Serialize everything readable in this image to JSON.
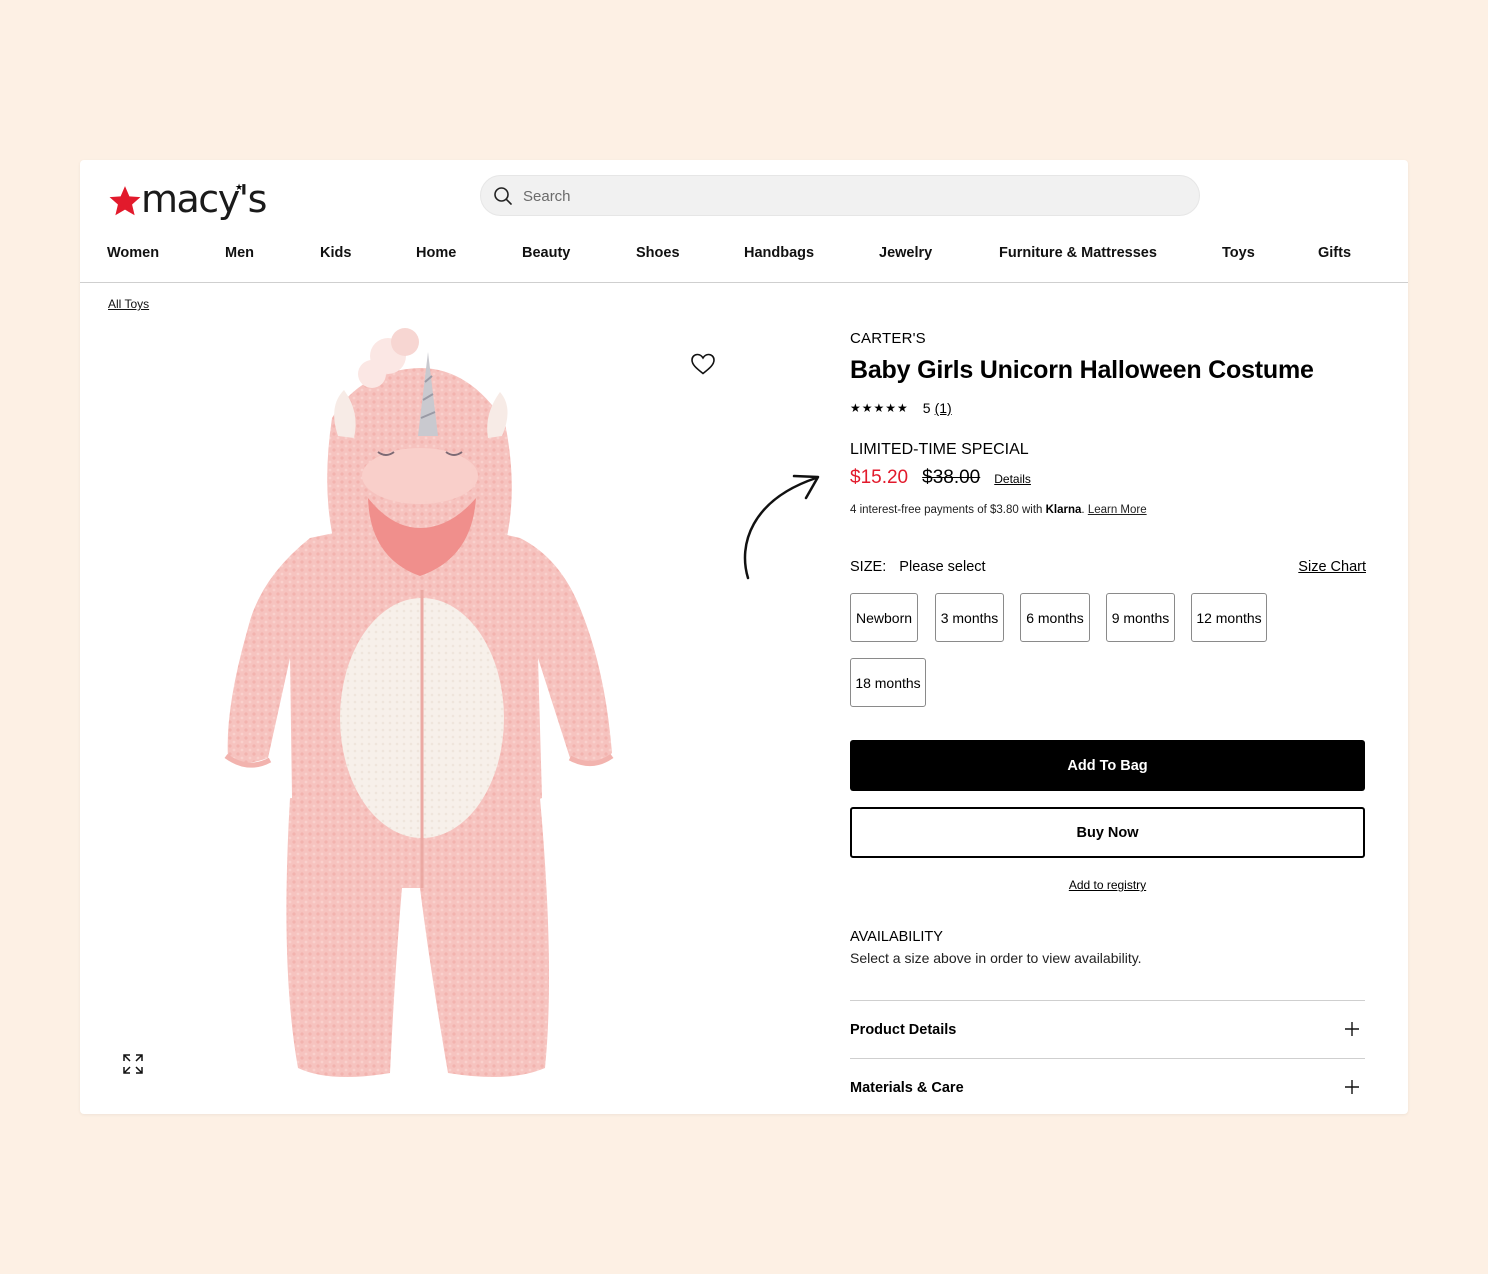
{
  "header": {
    "logo_text": "macy's",
    "search": {
      "placeholder": "Search"
    }
  },
  "nav": [
    "Women",
    "Men",
    "Kids",
    "Home",
    "Beauty",
    "Shoes",
    "Handbags",
    "Jewelry",
    "Furniture & Mattresses",
    "Toys",
    "Gifts"
  ],
  "breadcrumb": "All Toys",
  "product": {
    "brand": "CARTER'S",
    "title": "Baby Girls Unicorn Halloween Costume",
    "rating": {
      "stars": "★★★★★",
      "score": "5",
      "count": "(1)"
    },
    "promo": "LIMITED-TIME SPECIAL",
    "price_sale": "$15.20",
    "price_original": "$38.00",
    "details_link": "Details",
    "klarna": {
      "prefix": "4 interest-free payments of $3.80 with",
      "brand": "Klarna",
      "suffix": ".",
      "learn_more": "Learn More"
    },
    "size": {
      "label": "SIZE:",
      "selected": "Please select",
      "chart_link": "Size Chart",
      "options": [
        "Newborn",
        "3 months",
        "6 months",
        "9 months",
        "12 months",
        "18 months"
      ]
    },
    "add_to_bag": "Add To Bag",
    "buy_now": "Buy Now",
    "registry": "Add to registry",
    "availability": {
      "heading": "AVAILABILITY",
      "text": "Select a size above in order to view availability."
    },
    "accordions": [
      "Product Details",
      "Materials & Care"
    ]
  },
  "colors": {
    "background": "#fdf0e4",
    "sale_red": "#e21a2c",
    "brand_star": "#e21a2c",
    "costume_pink": "#f6c3bf",
    "belly_cream": "#f7f0ea"
  }
}
